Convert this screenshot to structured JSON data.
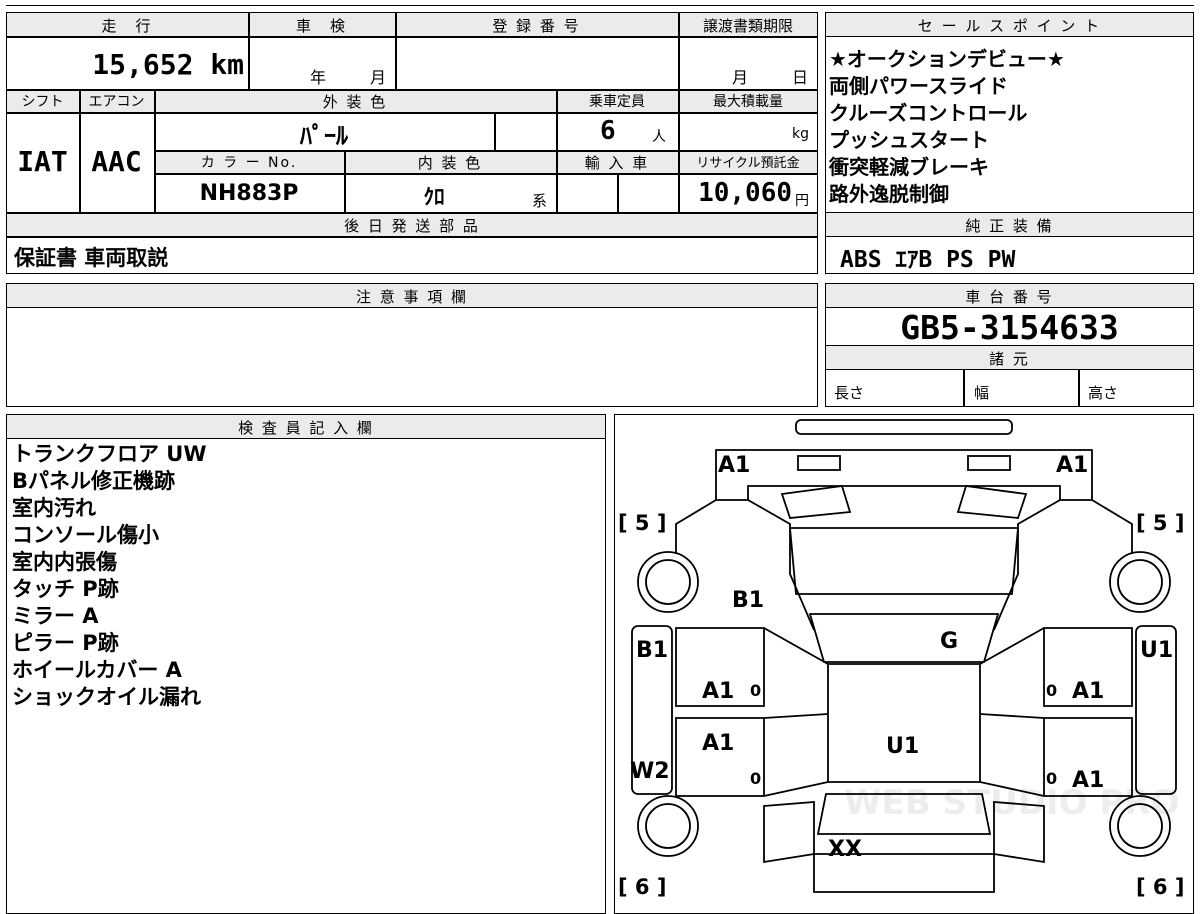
{
  "main": {
    "h_mileage": "走　行",
    "mileage": "15,652 km",
    "h_shaken": "車　検",
    "shaken_year": "年",
    "shaken_month": "月",
    "h_reg": "登 録 番 号",
    "reg_number": "",
    "h_deadline": "譲渡書類期限",
    "deadline_month": "月",
    "deadline_day": "日",
    "h_shift": "シフト",
    "shift": "IAT",
    "h_aircon": "エアコン",
    "aircon": "AAC",
    "h_ext": "外 装 色",
    "ext_color": "ﾊﾟｰﾙ",
    "h_capacity": "乗車定員",
    "capacity": "6",
    "capacity_unit": "人",
    "h_load": "最大積載量",
    "load_unit": "kg",
    "h_colorno": "カ ラ ー No.",
    "color_no": "NH883P",
    "h_int": "内 装 色",
    "int_color": "ｸﾛ",
    "int_suffix": "系",
    "h_import": "輸 入 車",
    "h_recycle": "リサイクル預託金",
    "recycle": "10,060",
    "recycle_unit": "円",
    "h_later": "後 日 発 送 部 品",
    "later_parts": "保証書 車両取説",
    "h_notes": "注 意 事 項 欄"
  },
  "sales": {
    "header": "セ ー ル ス ポ イ ン ト",
    "points": [
      "★オークションデビュー★",
      "両側パワースライド",
      "クルーズコントロール",
      "プッシュスタート",
      "衝突軽減ブレーキ",
      "路外逸脱制御"
    ]
  },
  "equipment": {
    "header": "純 正 装 備",
    "items": "ABS ｴｱB PS PW"
  },
  "chassis": {
    "header": "車 台 番 号",
    "number": "GB5-3154633"
  },
  "specs": {
    "header": "諸 元",
    "length": "長さ",
    "width": "幅",
    "height": "高さ"
  },
  "inspector": {
    "header": "検 査 員 記 入 欄",
    "lines": [
      "トランクフロア UW",
      "Bパネル修正機跡",
      "室内汚れ",
      "コンソール傷小",
      "室内内張傷",
      "タッチ P跡",
      "ミラー A",
      "ピラー P跡",
      "ホイールカバー A",
      "ショックオイル漏れ"
    ]
  },
  "diagram": {
    "marks": {
      "front_left": "A1",
      "front_right": "A1",
      "bracket_fl": "[ 5 ]",
      "bracket_fr": "[ 5 ]",
      "bracket_rl": "[ 6 ]",
      "bracket_rr": "[ 6 ]",
      "hood_left": "B1",
      "roof": "G",
      "side_left": "B1",
      "side_right": "U1",
      "door_fl": "A1",
      "door_rl": "A1",
      "door_fr": "A1",
      "door_rr": "A1",
      "center": "U1",
      "sill_left": "W2",
      "rear": "XX",
      "zero_fl": "0",
      "zero_rl": "0",
      "zero_fr": "0",
      "zero_rr": "0"
    },
    "watermark": "WEB STUDIO PRO"
  }
}
